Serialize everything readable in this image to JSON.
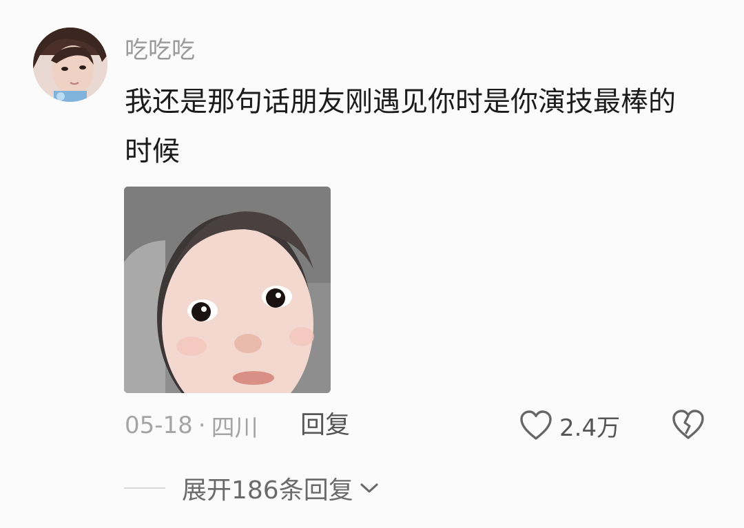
{
  "comment": {
    "username": "吃吃吃",
    "content": "我还是那句话朋友刚遇见你时是你演技最棒的时候",
    "date": "05-18",
    "separator": "·",
    "location": "四川",
    "reply_label": "回复",
    "like_count": "2.4万",
    "expand_replies_label": "展开186条回复"
  },
  "icons": {
    "avatar": "user-avatar",
    "sticker": "baby-face-sticker",
    "like": "heart-outline-icon",
    "dislike": "broken-heart-icon",
    "expand": "chevron-down-icon"
  },
  "colors": {
    "background": "#fbfbfb",
    "username": "#9a9a9a",
    "content_text": "#1b1b1b",
    "meta_text": "#a4a4a4",
    "action_text": "#555555"
  }
}
